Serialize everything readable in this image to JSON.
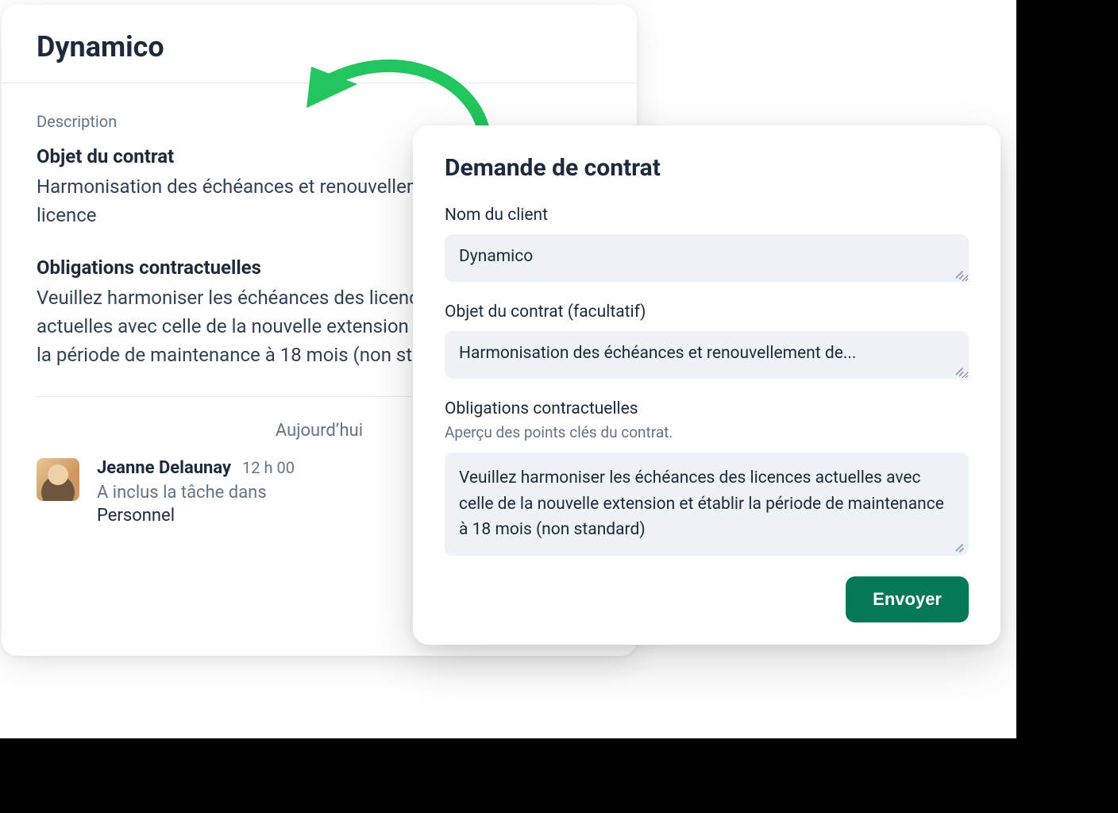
{
  "colors": {
    "accent": "#047857"
  },
  "detail": {
    "title": "Dynamico",
    "description_label": "Description",
    "subject_heading": "Objet du contrat",
    "subject_text": "Harmonisation des échéances et renouvellement de licence",
    "obligations_heading": "Obligations contractuelles",
    "obligations_text": "Veuillez harmoniser les échéances des licences actuelles avec celle de la nouvelle extension et établir la période de maintenance à 18 mois (non standard)"
  },
  "activity": {
    "day_label": "Aujourd’hui",
    "user": "Jeanne Delaunay",
    "time": "12 h 00",
    "line1": "A inclus la tâche dans",
    "line2": "Personnel"
  },
  "form": {
    "title": "Demande de contrat",
    "client_label": "Nom du client",
    "client_value": "Dynamico",
    "subject_label": "Objet du contrat (facultatif)",
    "subject_value": "Harmonisation des échéances et renouvellement de...",
    "obligations_label": "Obligations contractuelles",
    "obligations_help": "Aperçu des points clés du contrat.",
    "obligations_value": "Veuillez harmoniser les échéances des licences actuelles avec celle de la nouvelle extension et établir la période de maintenance à 18 mois (non standard)",
    "submit_label": "Envoyer"
  }
}
